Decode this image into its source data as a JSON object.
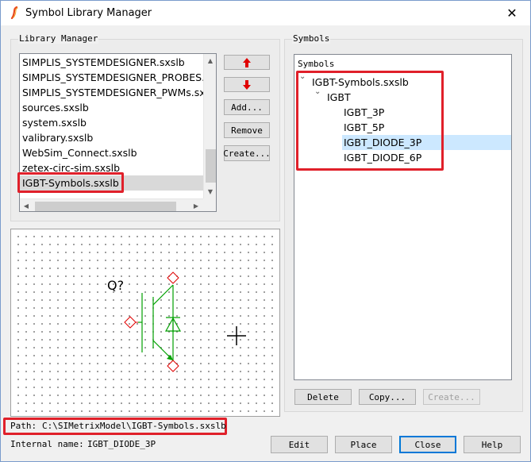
{
  "window": {
    "title": "Symbol Library Manager",
    "close_glyph": "✕"
  },
  "library_manager": {
    "label": "Library Manager",
    "items": [
      "SIMPLIS_SYSTEMDESIGNER.sxslb",
      "SIMPLIS_SYSTEMDESIGNER_PROBES.sx",
      "SIMPLIS_SYSTEMDESIGNER_PWMs.sxsl",
      "sources.sxslb",
      "system.sxslb",
      "valibrary.sxslb",
      "WebSim_Connect.sxslb",
      "zetex-circ-sim.sxslb",
      "IGBT-Symbols.sxslb"
    ],
    "selected_index": 8,
    "buttons": {
      "up_icon": "up-arrow-icon",
      "down_icon": "down-arrow-icon",
      "add": "Add...",
      "remove": "Remove",
      "create": "Create..."
    }
  },
  "symbols": {
    "group_label": "Symbols",
    "header": "Symbols",
    "tree": [
      {
        "label": "IGBT-Symbols.sxslb",
        "level": 0,
        "expanded": true
      },
      {
        "label": "IGBT",
        "level": 1,
        "expanded": true
      },
      {
        "label": "IGBT_3P",
        "level": 2
      },
      {
        "label": "IGBT_5P",
        "level": 2
      },
      {
        "label": "IGBT_DIODE_3P",
        "level": 2,
        "selected": true
      },
      {
        "label": "IGBT_DIODE_6P",
        "level": 2
      }
    ],
    "buttons": {
      "delete": "Delete",
      "copy": "Copy...",
      "create": "Create..."
    }
  },
  "preview": {
    "ref_label": "Q?"
  },
  "path": {
    "label": "Path:",
    "value": "C:\\SIMetrixModel\\IGBT-Symbols.sxslb"
  },
  "internal_name": {
    "label": "Internal name:",
    "value": "IGBT_DIODE_3P"
  },
  "footer_buttons": {
    "edit": "Edit",
    "place": "Place",
    "close": "Close",
    "help": "Help"
  },
  "colors": {
    "highlight": "#e0202a",
    "selection": "#cce8ff",
    "symbol_green": "#00a000",
    "pin_red": "#e00000"
  }
}
